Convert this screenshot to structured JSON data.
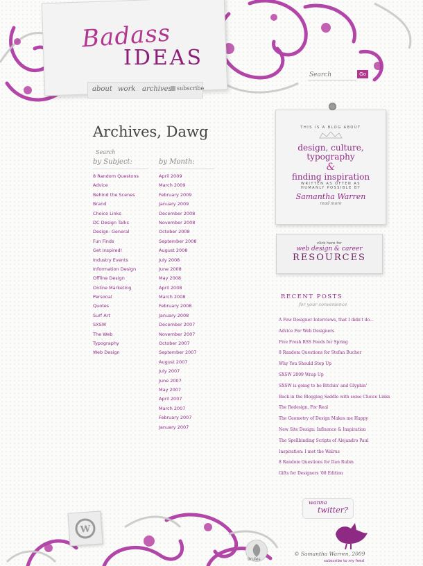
{
  "header": {
    "logo_line1": "Badass",
    "logo_line2": "IDEAS",
    "nav": [
      "about",
      "work",
      "archives"
    ],
    "subscribe_label": "subscribe",
    "search_placeholder": "Search",
    "search_button": "Go"
  },
  "main": {
    "title": "Archives, Dawg",
    "search_caption": "Search",
    "subject_heading": "by Subject:",
    "month_heading": "by Month:",
    "subjects": [
      "8 Random Questons",
      "Advice",
      "Behind the Scenes",
      "Brand",
      "Choice Links",
      "DC Design Talks",
      "Design- General",
      "Fun Finds",
      "Get Inspired!",
      "Industry Events",
      "Information Design",
      "Offline Design",
      "Online Marketing",
      "Personal",
      "Quotes",
      "Surf Art",
      "SXSW",
      "The Web",
      "Typography",
      "Web Design"
    ],
    "months": [
      "April 2009",
      "March 2009",
      "February 2009",
      "January 2009",
      "December 2008",
      "November 2008",
      "October 2008",
      "September 2008",
      "August 2008",
      "July 2008",
      "June 2008",
      "May 2008",
      "April 2008",
      "March 2008",
      "February 2008",
      "January 2008",
      "December 2007",
      "November 2007",
      "October 2007",
      "September 2007",
      "August 2007",
      "July 2007",
      "June 2007",
      "May 2007",
      "April 2007",
      "March 2007",
      "February 2007",
      "January 2007"
    ]
  },
  "sidebar": {
    "about": {
      "intro": "THIS IS A BLOG ABOUT",
      "topic1": "design, culture,",
      "topic2": "typography",
      "amp": "&",
      "topic3": "finding inspiration",
      "written1": "WRITTEN AS OFTEN AS",
      "written2": "HUMANLY POSSIBLE BY",
      "author": "Samantha Warren",
      "more": "read more"
    },
    "resources": {
      "line1": "click here for",
      "line2": "web design & career",
      "line3": "RESOURCES"
    },
    "recent_title": "RECENT POSTS",
    "recent_subtitle": "for your convenience",
    "recent_posts": [
      "A Few Designer Interviews, that I didn't do...",
      "Advice For Web Designers",
      "Five Fresh RSS Feeds for Spring",
      "8 Random Questions for Stefan Bucher",
      "Why You Should Step Up",
      "SXSW 2009 Wrap Up",
      "SXSW is going to be Bitchin' and Glyphin'",
      "Back in the Blogging Saddle with some Choice Links",
      "The Redesign, For Real",
      "The Geometry of Design Makes me Happy",
      "New Site Design: Influence & Inspiration",
      "The Spellbinding Scripts of Alejandro Paul",
      "Inspiration: I met the Walrus",
      "8 Random Questions for Dan Rubin",
      "Gifts for Designers '08 Edition"
    ]
  },
  "footer": {
    "twitter_wanna": "wanna",
    "twitter_word": "twitter?",
    "copyright": "© Samantha Warren, 2009",
    "feed_link": "subscribe to my feed",
    "badge_label": "9rules"
  },
  "colors": {
    "accent": "#8e2a84",
    "accent_light": "#b2358f",
    "text": "#444444",
    "background": "#fbfbfa"
  },
  "icons": [
    "rss-icon",
    "pushpin-icon",
    "wordpress-icon",
    "9rules-leaf-icon",
    "bird-icon"
  ]
}
